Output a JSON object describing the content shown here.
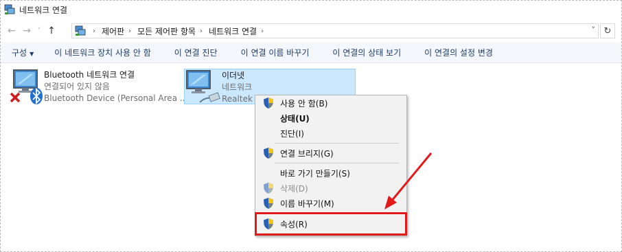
{
  "window": {
    "title": "네트워크 연결",
    "icon": "network-connections-icon"
  },
  "nav": {
    "back_icon": "←",
    "forward_icon": "→",
    "recent_icon": "˅",
    "up_icon": "↑",
    "breadcrumb": [
      "제어판",
      "모든 제어판 항목",
      "네트워크 연결"
    ],
    "breadcrumb_separator": "›",
    "dropdown_icon": "˅",
    "refresh_icon": "↻"
  },
  "toolbar": {
    "organize": "구성",
    "organize_caret": "▼",
    "commands": [
      "이 네트워크 장치 사용 안 함",
      "이 연결 진단",
      "이 연결 이름 바꾸기",
      "이 연결의 상태 보기",
      "이 연결의 설정 변경"
    ]
  },
  "connections": [
    {
      "name": "Bluetooth 네트워크 연결",
      "status": "연결되어 있지 않음",
      "device": "Bluetooth Device (Personal Area ..."
    },
    {
      "name": "이더넷",
      "status": "네트워크",
      "device": "Realtek P"
    }
  ],
  "context_menu": {
    "items": [
      {
        "label": "사용 안 함(B)",
        "shield": true
      },
      {
        "label": "상태(U)",
        "bold": true
      },
      {
        "label": "진단(I)"
      },
      {
        "label": "연결 브리지(G)",
        "shield": true
      },
      {
        "label": "바로 가기 만들기(S)"
      },
      {
        "label": "삭제(D)",
        "shield": true,
        "disabled": true
      },
      {
        "label": "이름 바꾸기(M)",
        "shield": true
      },
      {
        "label": "속성(R)",
        "shield": true
      }
    ]
  },
  "annotation": {
    "box_color": "#e21a1a",
    "arrow_color": "#e21a1a"
  },
  "colors": {
    "selection_bg": "#cce8ff",
    "toolbar_bg": "#f3f6fb",
    "command_text": "#1f3d66"
  }
}
